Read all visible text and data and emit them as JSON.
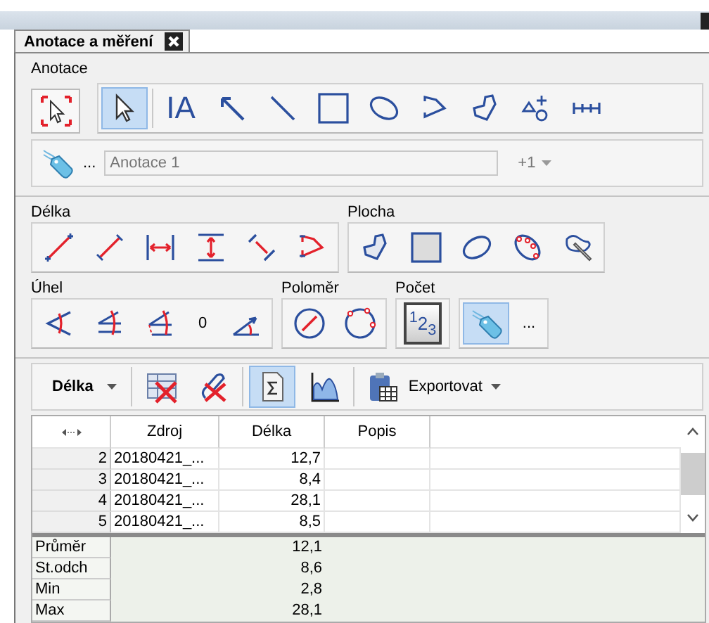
{
  "tab": {
    "title": "Anotace a měření"
  },
  "annotation": {
    "label": "Anotace",
    "region_tool": {
      "selected": false
    },
    "tools": [
      {
        "kind": "icon",
        "selected": true
      },
      {
        "kind": "text",
        "text": "IA",
        "selected": false
      },
      {
        "kind": "icon",
        "selected": false
      },
      {
        "kind": "icon",
        "selected": false
      },
      {
        "kind": "icon",
        "selected": false
      },
      {
        "kind": "icon",
        "selected": false
      },
      {
        "kind": "icon",
        "selected": false
      },
      {
        "kind": "icon",
        "selected": false
      },
      {
        "kind": "icon",
        "selected": false
      },
      {
        "kind": "icon",
        "selected": false
      }
    ],
    "more": "...",
    "name_field": {
      "placeholder": "Anotace 1"
    },
    "count": "+1"
  },
  "measure_rows": [
    [
      {
        "label": "Délka",
        "items": [
          {
            "kind": "icon",
            "selected": false
          },
          {
            "kind": "icon",
            "selected": false
          },
          {
            "kind": "icon",
            "selected": false
          },
          {
            "kind": "icon",
            "selected": false
          },
          {
            "kind": "icon",
            "selected": false
          },
          {
            "kind": "icon",
            "selected": false
          }
        ]
      },
      {
        "label": "Plocha",
        "items": [
          {
            "kind": "icon",
            "selected": false
          },
          {
            "kind": "icon",
            "selected": false
          },
          {
            "kind": "icon",
            "selected": false
          },
          {
            "kind": "icon",
            "selected": false
          },
          {
            "kind": "icon",
            "selected": false
          }
        ]
      }
    ],
    [
      {
        "label": "Úhel",
        "items": [
          {
            "kind": "icon",
            "selected": false
          },
          {
            "kind": "icon",
            "selected": false
          },
          {
            "kind": "icon",
            "selected": false
          },
          {
            "kind": "text",
            "text": "0"
          },
          {
            "kind": "icon",
            "selected": false
          }
        ]
      },
      {
        "label": "Poloměr",
        "items": [
          {
            "kind": "icon",
            "selected": false
          },
          {
            "kind": "icon",
            "selected": false
          }
        ]
      },
      {
        "label": "Počet",
        "items": [
          {
            "kind": "counter",
            "text": "$^{1}$2$_{3}$",
            "selected": false
          }
        ]
      },
      {
        "items": [
          {
            "kind": "icon",
            "selected": true
          },
          {
            "kind": "text",
            "text": "..."
          }
        ]
      }
    ]
  ],
  "results_toolbar": {
    "measure": "Délka",
    "tools": [
      {
        "selected": false
      },
      {
        "selected": false
      },
      {
        "selected": true
      },
      {
        "selected": false
      }
    ],
    "export": "Exportovat"
  },
  "table": {
    "columns": [
      "Zdroj",
      "Délka",
      "Popis"
    ],
    "rows": [
      {
        "index": "2",
        "source": "20180421_...",
        "value": "12,7"
      },
      {
        "index": "3",
        "source": "20180421_...",
        "value": "8,4"
      },
      {
        "index": "4",
        "source": "20180421_...",
        "value": "28,1"
      },
      {
        "index": "5",
        "source": "20180421_...",
        "value": "8,5"
      }
    ],
    "stats": [
      {
        "label": "Průměr",
        "value": "12,1"
      },
      {
        "label": "St.odch",
        "value": "8,6"
      },
      {
        "label": "Min",
        "value": "2,8"
      },
      {
        "label": "Max",
        "value": "28,1"
      }
    ]
  }
}
